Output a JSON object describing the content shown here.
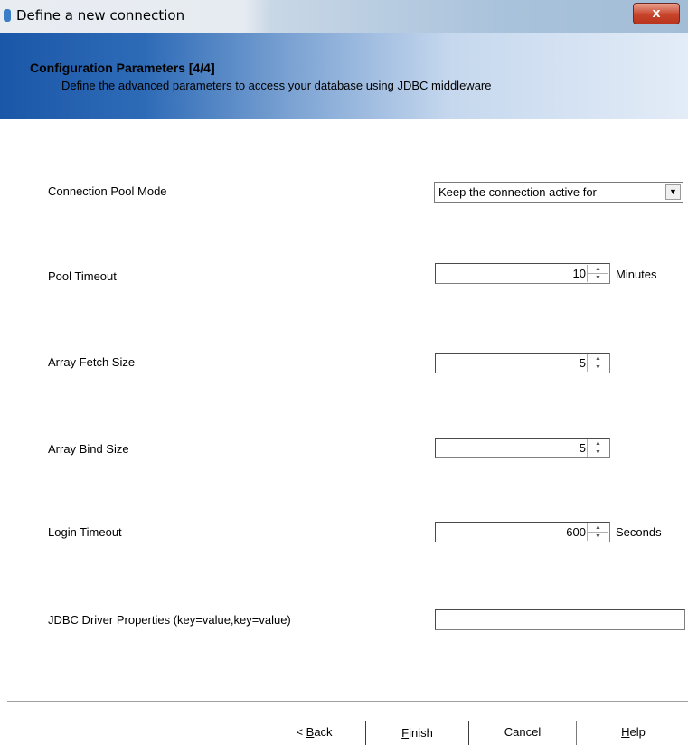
{
  "window": {
    "title": "Define a new connection",
    "close_label": "x"
  },
  "header": {
    "title": "Configuration Parameters [4/4]",
    "subtitle": "Define the advanced parameters to access your database using JDBC middleware"
  },
  "form": {
    "connection_pool_mode": {
      "label": "Connection Pool Mode",
      "value": "Keep the connection active for"
    },
    "pool_timeout": {
      "label": "Pool Timeout",
      "value": "10",
      "unit": "Minutes"
    },
    "array_fetch_size": {
      "label": "Array Fetch Size",
      "value": "5"
    },
    "array_bind_size": {
      "label": "Array Bind Size",
      "value": "5"
    },
    "login_timeout": {
      "label": "Login Timeout",
      "value": "600",
      "unit": "Seconds"
    },
    "jdbc_driver_properties": {
      "label": "JDBC Driver Properties (key=value,key=value)",
      "value": ""
    }
  },
  "buttons": {
    "back": {
      "prefix": "< ",
      "mnemonic": "B",
      "rest": "ack"
    },
    "finish": {
      "mnemonic": "F",
      "rest": "inish"
    },
    "cancel": {
      "label": "Cancel"
    },
    "help": {
      "mnemonic": "H",
      "rest": "elp"
    }
  },
  "icons": {
    "app": "app-icon",
    "close": "close-icon",
    "dropdown": "chevron-down-icon",
    "spin_up": "spin-up-icon",
    "spin_down": "spin-down-icon"
  }
}
